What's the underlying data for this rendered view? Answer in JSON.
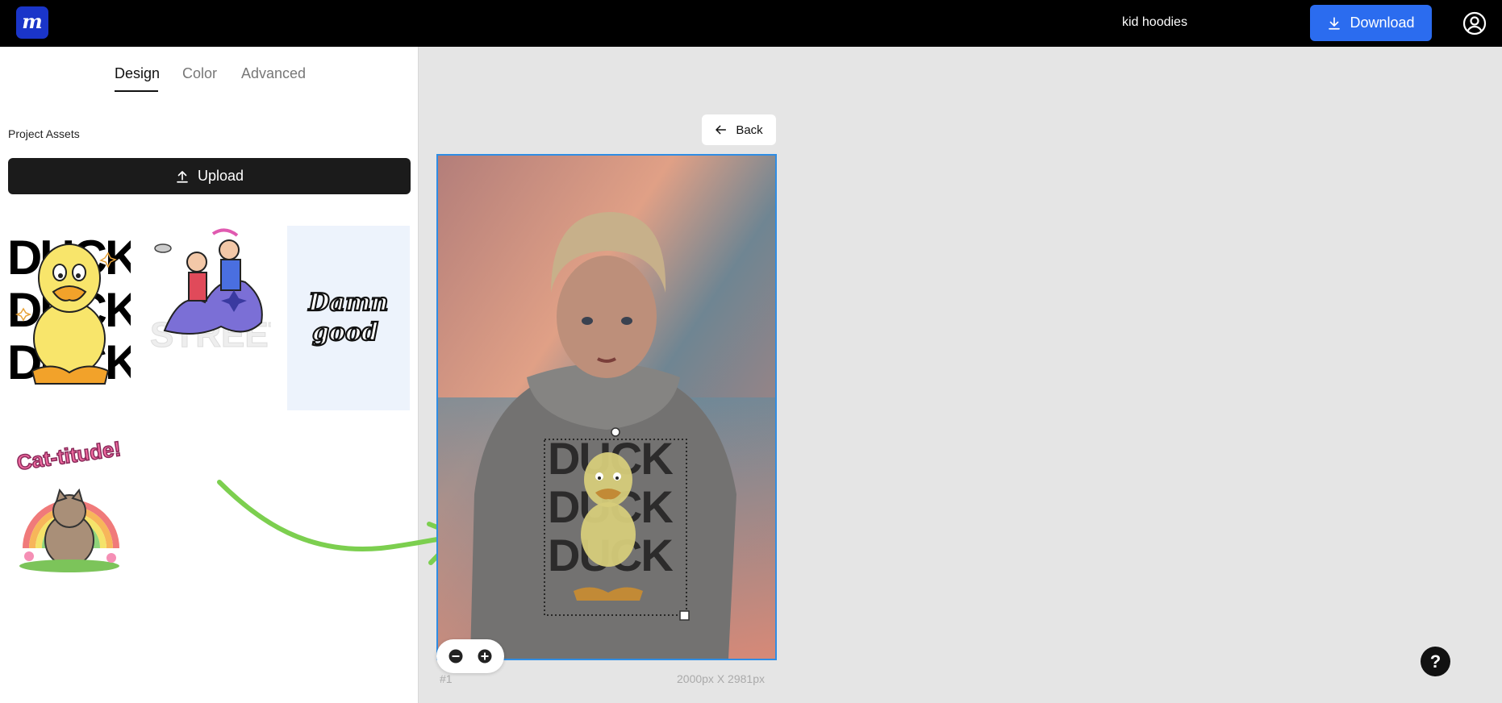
{
  "header": {
    "logo_letter": "m",
    "project_title": "kid hoodies",
    "download_label": "Download",
    "colors": {
      "background": "#000000",
      "logo": "#1a35c9",
      "download": "#2b6cef"
    }
  },
  "sidebar": {
    "tabs": [
      {
        "label": "Design",
        "active": true
      },
      {
        "label": "Color",
        "active": false
      },
      {
        "label": "Advanced",
        "active": false
      }
    ],
    "section_label": "Project Assets",
    "upload_label": "Upload",
    "assets": [
      {
        "name": "duck-design",
        "text": "DUCK"
      },
      {
        "name": "street-design",
        "text": "STREET"
      },
      {
        "name": "damn-good-design",
        "text_line1": "Damn",
        "text_line2": "good"
      },
      {
        "name": "cat-titude-design",
        "text": "Cat-titude!"
      }
    ]
  },
  "canvas": {
    "back_label": "Back",
    "page_number": "#1",
    "dimensions": "2000px X 2981px",
    "overlay_text": "DUCK",
    "selection_color": "#2f8de4"
  },
  "help_label": "?"
}
